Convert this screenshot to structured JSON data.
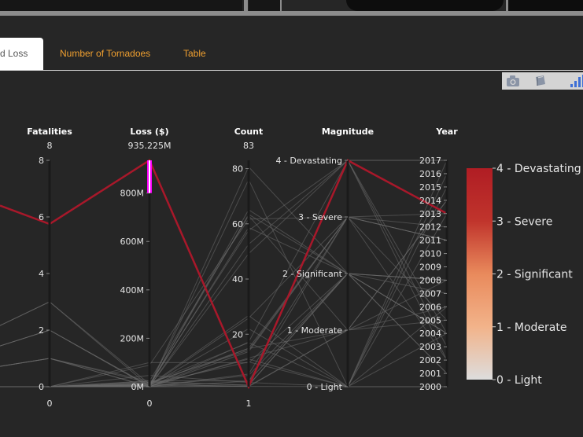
{
  "tabs": [
    {
      "label": "d Loss",
      "active": true
    },
    {
      "label": "Number of Tornadoes",
      "active": false
    },
    {
      "label": "Table",
      "active": false
    }
  ],
  "modebar": {
    "icons": [
      "camera-icon",
      "edit-in-chart-studio-icon",
      "plotly-logo-icon"
    ]
  },
  "chart_data": {
    "type": "parallel-coordinates",
    "dimensions": [
      {
        "label": "Fatalities",
        "value_label": "8",
        "range": [
          0,
          8
        ],
        "ticks": [
          "0",
          "2",
          "4",
          "6",
          "8"
        ],
        "bottom_label": "0"
      },
      {
        "label": "Loss ($)",
        "value_label": "935.225M",
        "range": [
          0,
          935.225
        ],
        "ticks": [
          "0M",
          "200M",
          "400M",
          "600M",
          "800M"
        ],
        "bottom_label": "0",
        "constraint_range": [
          800,
          935.225
        ]
      },
      {
        "label": "Count",
        "value_label": "83",
        "range": [
          1,
          83
        ],
        "ticks": [
          "20",
          "40",
          "60",
          "80"
        ],
        "bottom_label": "1"
      },
      {
        "label": "Magnitude",
        "range": [
          0,
          4
        ],
        "ticks": [
          "0 - Light",
          "1 - Moderate",
          "2 - Significant",
          "3 - Severe",
          "4 - Devastating"
        ]
      },
      {
        "label": "Year",
        "range": [
          2000,
          2017
        ],
        "ticks": [
          "2000",
          "2001",
          "2002",
          "2003",
          "2004",
          "2005",
          "2006",
          "2007",
          "2008",
          "2009",
          "2010",
          "2011",
          "2012",
          "2013",
          "2014",
          "2015",
          "2016",
          "2017"
        ]
      }
    ],
    "colorscale": {
      "colors": [
        "#dddddd",
        "#f2b38a",
        "#e98a5c",
        "#c0342c",
        "#b01d24"
      ],
      "ticks": [
        "0 - Light",
        "1 - Moderate",
        "2 - Significant",
        "3 - Severe",
        "4 - Devastating"
      ]
    },
    "highlighted_line": {
      "color": "#a8182a"
    },
    "line_color": "#6b6b6b",
    "text_color": "#ffffff",
    "background": "#262626"
  }
}
